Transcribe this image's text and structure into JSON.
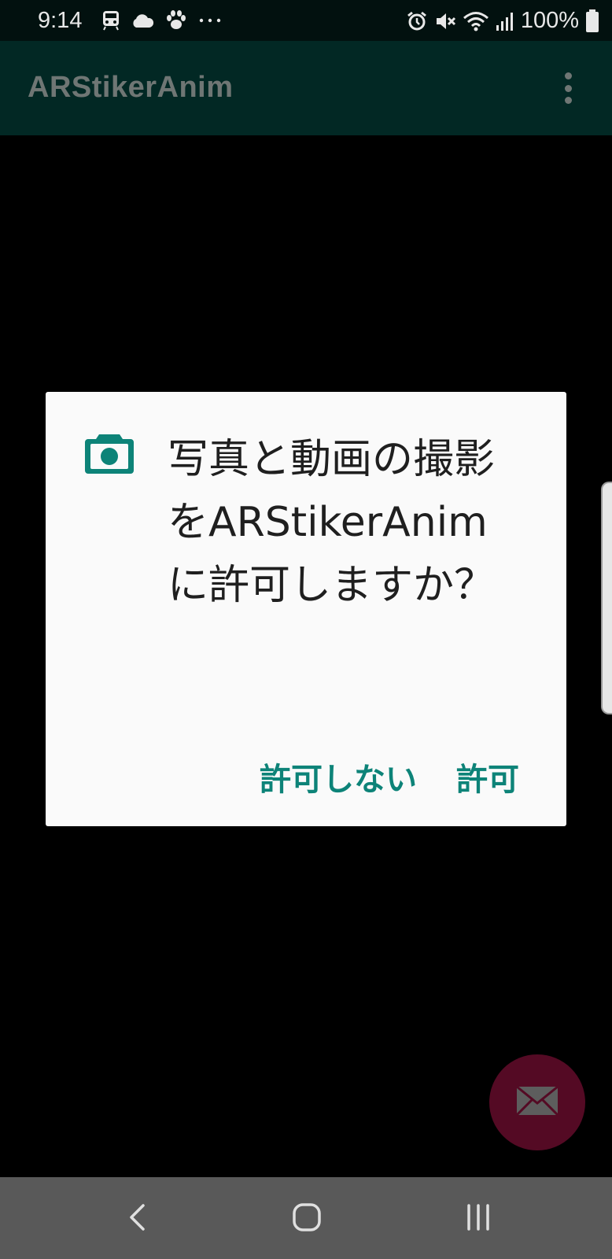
{
  "status_bar": {
    "time": "9:14",
    "left_icons": [
      "train-icon",
      "cloud-icon",
      "paw-icon",
      "more-notifications-icon"
    ],
    "right_icons": [
      "alarm-icon",
      "mute-icon",
      "wifi-icon",
      "signal-icon"
    ],
    "battery_text": "100%"
  },
  "app_bar": {
    "title": "ARStikerAnim"
  },
  "dialog": {
    "icon": "camera-icon",
    "message": "写真と動画の撮影をARStikerAnimに許可しますか？",
    "deny_label": "許可しない",
    "allow_label": "許可",
    "accent_color": "#0d8378"
  },
  "fab": {
    "icon": "mail-icon",
    "color": "#540a24"
  },
  "nav_bar": {
    "buttons": [
      "back-icon",
      "home-icon",
      "recents-icon"
    ]
  }
}
